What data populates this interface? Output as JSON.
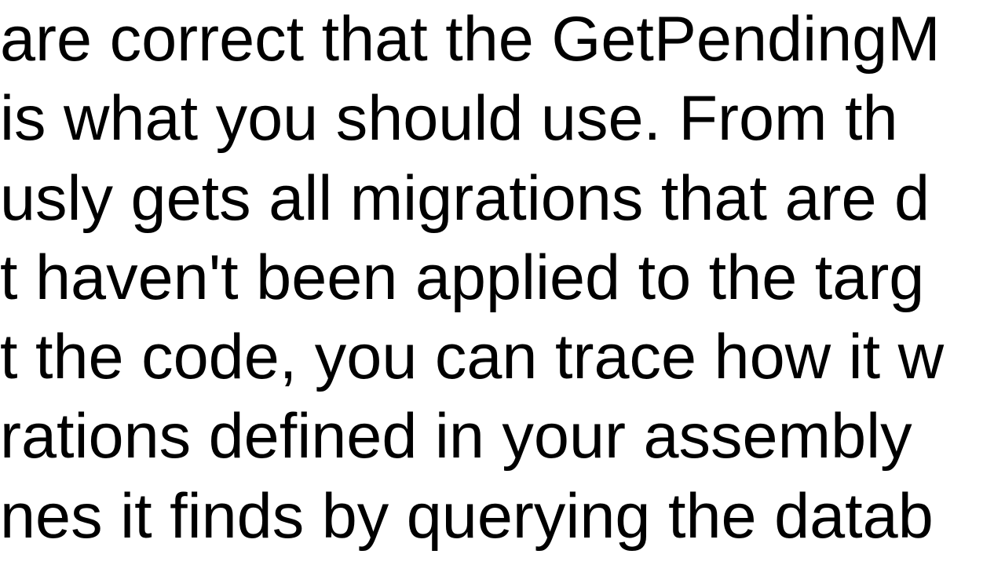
{
  "lines": [
    "are correct that the GetPendingM",
    " is what you should use. From th",
    "usly gets all migrations that are d",
    "t haven't been applied to the targ",
    "t the code, you can trace how it w",
    "rations defined in your assembly ",
    "nes it finds by querying the datab"
  ]
}
